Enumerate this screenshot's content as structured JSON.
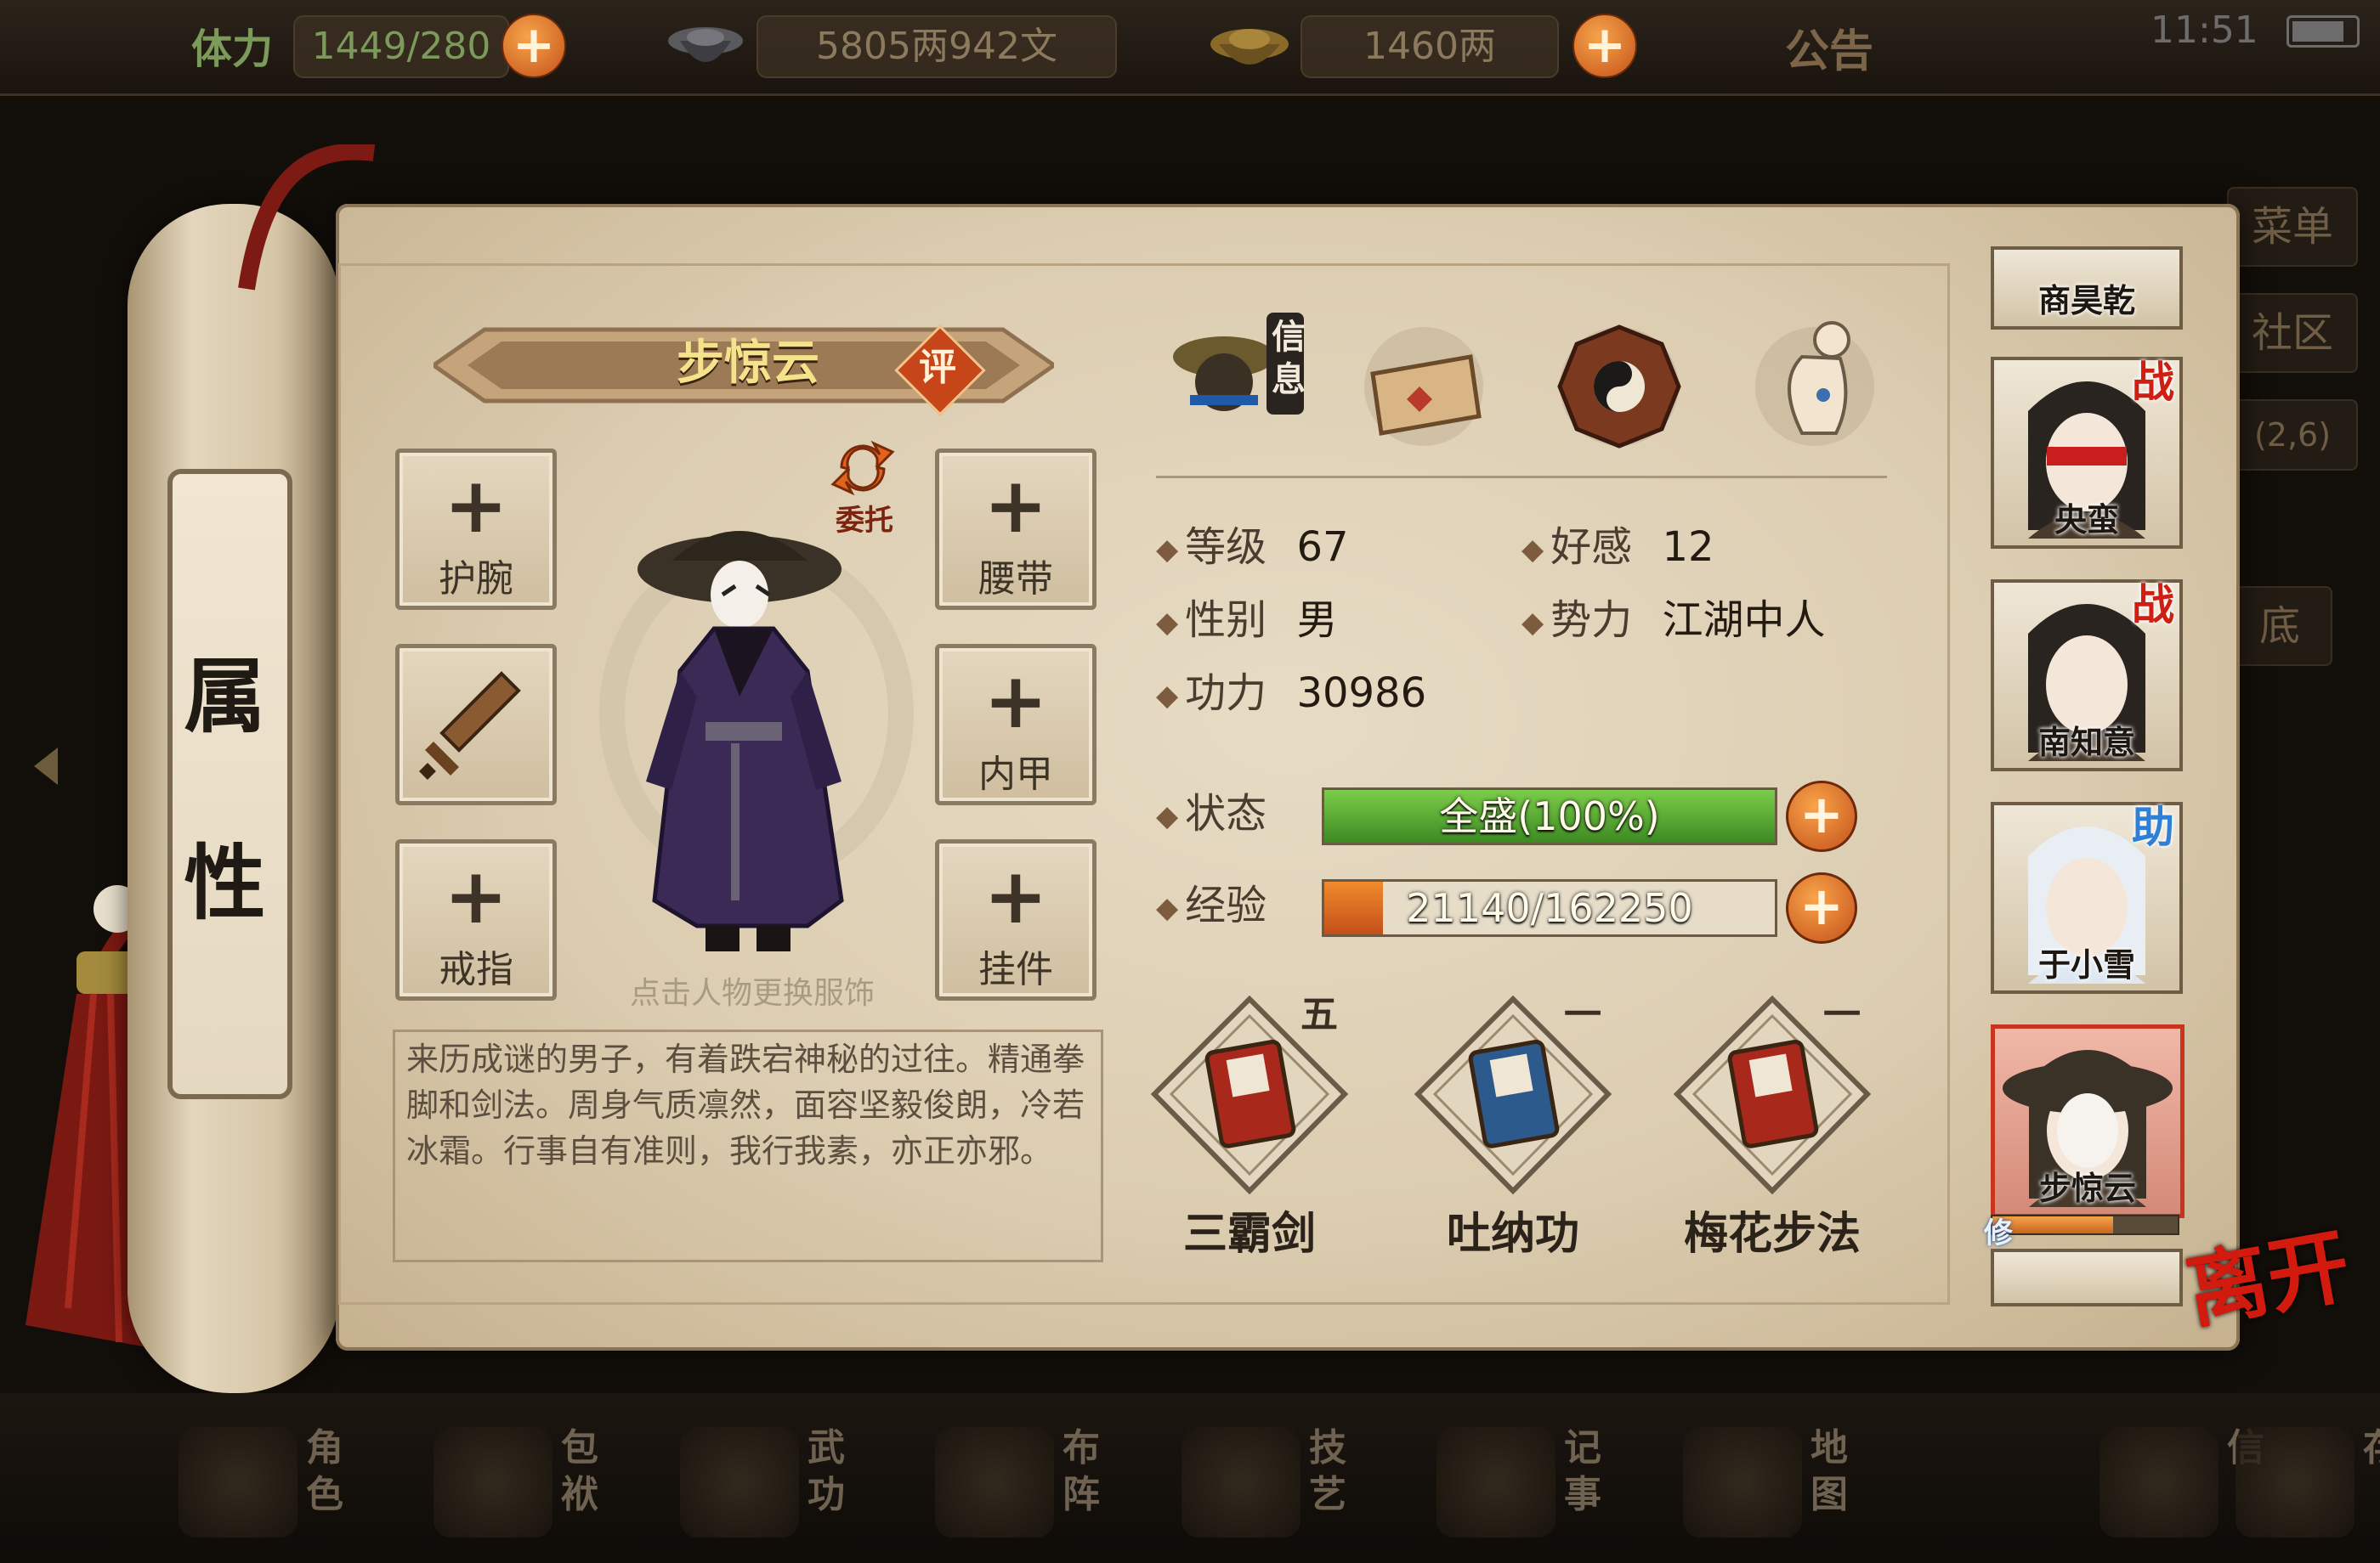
{
  "topbar": {
    "stamina_label": "体力",
    "stamina_value": "1449/280",
    "silver": "5805两942文",
    "gold": "1460两",
    "notice": "公告",
    "time": "11:51"
  },
  "side_menu": {
    "menu": "菜单",
    "community": "社区",
    "coords": "(2,6)",
    "bottom_label": "底"
  },
  "tab": {
    "label_top": "属",
    "label_bottom": "性"
  },
  "character": {
    "name": "步惊云",
    "rate_button": "评",
    "entrust": "委托",
    "change_hint": "点击人物更换服饰",
    "description": "来历成谜的男子，有着跌宕神秘的过往。精通拳脚和剑法。周身气质凛然，面容坚毅俊朗，冷若冰霜。行事自有准则，我行我素，亦正亦邪。"
  },
  "equipment": {
    "slot_plus": "+",
    "wrist": "护腕",
    "belt": "腰带",
    "armor": "内甲",
    "ring": "戒指",
    "pendant": "挂件"
  },
  "top_icons": {
    "info_label_1": "信",
    "info_label_2": "息"
  },
  "stats": {
    "level_label": "等级",
    "level": "67",
    "affection_label": "好感",
    "affection": "12",
    "gender_label": "性别",
    "gender": "男",
    "faction_label": "势力",
    "faction": "江湖中人",
    "power_label": "功力",
    "power": "30986",
    "status_label": "状态",
    "status_text": "全盛(100%)",
    "status_fraction": 1.0,
    "exp_label": "经验",
    "exp_text": "21140/162250",
    "exp_fraction": 0.13,
    "plus": "+"
  },
  "skills": [
    {
      "name": "三霸剑",
      "level": "五"
    },
    {
      "name": "吐纳功",
      "level": "一"
    },
    {
      "name": "梅花步法",
      "level": "一"
    }
  ],
  "roster": [
    {
      "name": "商昊乾",
      "badge": ""
    },
    {
      "name": "央蛮",
      "badge": "战"
    },
    {
      "name": "南知意",
      "badge": "战"
    },
    {
      "name": "于小雪",
      "badge": "助"
    },
    {
      "name": "步惊云",
      "badge": ""
    }
  ],
  "roster_extra": {
    "cultivate_badge": "修"
  },
  "leave_button": "离开",
  "bottom_nav": [
    {
      "a": "角",
      "b": "色"
    },
    {
      "a": "包",
      "b": "袱"
    },
    {
      "a": "武",
      "b": "功"
    },
    {
      "a": "布",
      "b": "阵"
    },
    {
      "a": "技",
      "b": "艺"
    },
    {
      "a": "记",
      "b": "事"
    },
    {
      "a": "地",
      "b": "图"
    },
    {
      "a": "信",
      "b": ""
    },
    {
      "a": "存",
      "b": ""
    }
  ],
  "colors": {
    "status_bar": "#4fa52a",
    "exp_bar": "#e06a1a",
    "accent_red": "#c6461a",
    "parchment": "#e3d6be"
  }
}
